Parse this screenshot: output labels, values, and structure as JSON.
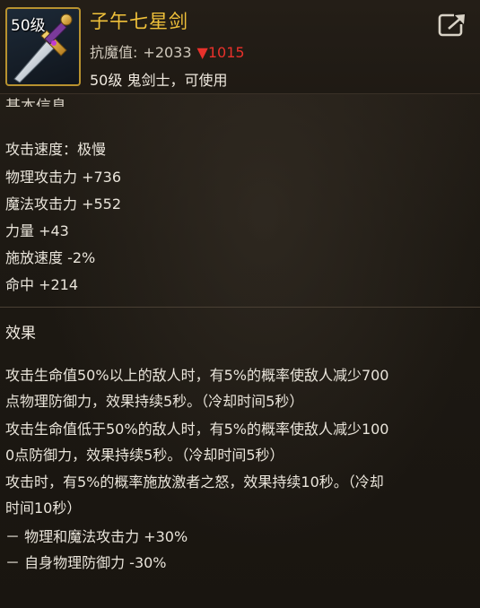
{
  "item": {
    "level_tag": "50级",
    "name": "子午七星剑",
    "resistance_label": "抗魔值:",
    "resistance_value": "+2033",
    "resistance_delta": "▼1015",
    "requirement": "50级 鬼剑士，可使用"
  },
  "basic_info": {
    "heading": "基本信息",
    "stats": [
      "攻击速度：极慢",
      "物理攻击力 +736",
      "魔法攻击力 +552",
      "力量 +43",
      "施放速度 -2%",
      "命中 +214"
    ]
  },
  "effects": {
    "heading": "效果",
    "lines": [
      "攻击生命值50%以上的敌人时，有5%的概率使敌人减少700",
      "点物理防御力，效果持续5秒。（冷却时间5秒）",
      "攻击生命值低于50%的敌人时，有5%的概率使敌人减少100",
      "0点防御力，效果持续5秒。（冷却时间5秒）",
      "攻击时，有5%的概率施放激者之怒，效果持续10秒。（冷却",
      "时间10秒）",
      "－ 物理和魔法攻击力 +30%",
      "－ 自身物理防御力 -30%"
    ]
  },
  "colors": {
    "name": "#f0c13a",
    "delta_down": "#e8312b",
    "icon_border": "#b8922f"
  },
  "icons": {
    "item_icon": "dagger-icon",
    "share": "share-icon"
  }
}
